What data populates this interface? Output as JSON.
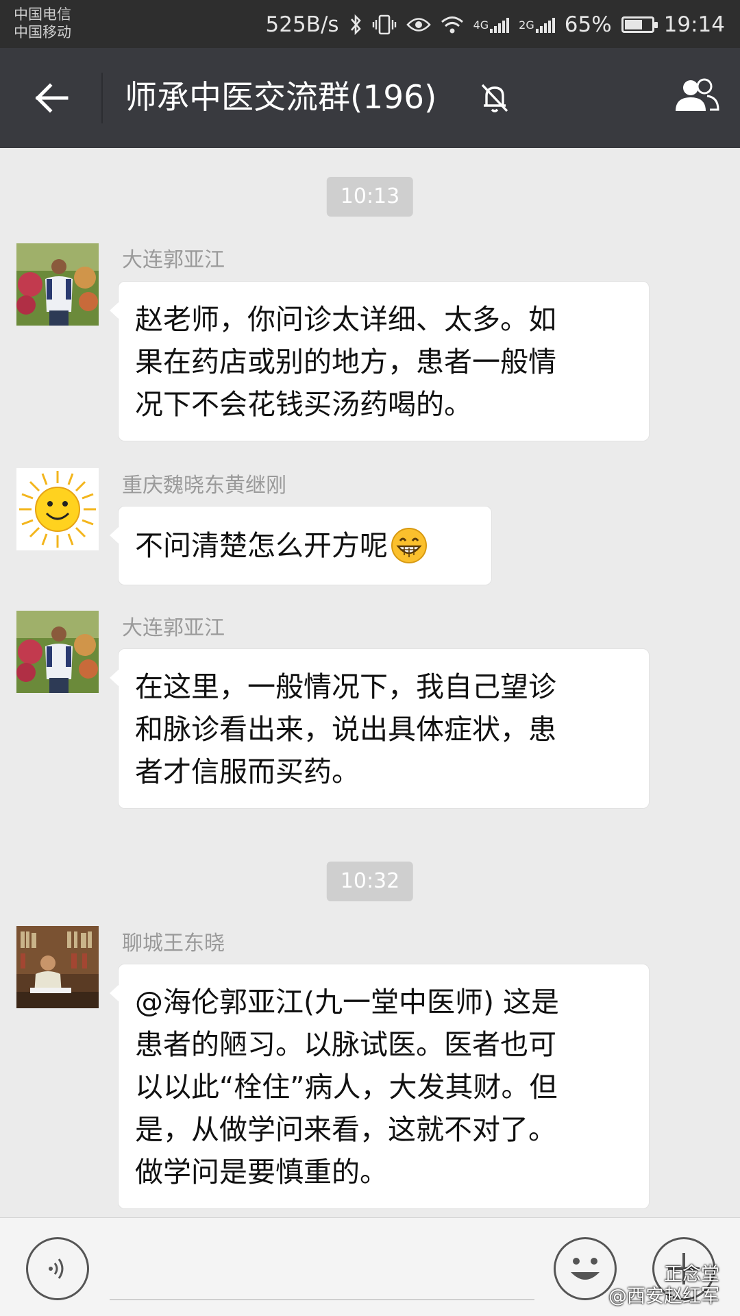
{
  "status_bar": {
    "carrier_1": "中国电信",
    "carrier_2": "中国移动",
    "net_speed": "525B/s",
    "net_4g": "4G",
    "net_2g": "2G",
    "battery": "65%",
    "time": "19:14",
    "battery_level": 0.65
  },
  "header": {
    "title": "师承中医交流群(196)",
    "back_icon": "arrow-left-icon",
    "mute_icon": "bell-muted-icon",
    "members_icon": "group-members-icon"
  },
  "messages": [
    {
      "type": "time",
      "text": "10:13"
    },
    {
      "sender": "大连郭亚江",
      "avatar": "photo-man-outdoor",
      "lines": [
        "赵老师，你问诊太详细、太多。如",
        "果在药店或别的地方，患者一般情",
        "况下不会花钱买汤药喝的。"
      ]
    },
    {
      "sender": "重庆魏晓东黄继刚",
      "avatar": "smiling-sun",
      "lines": [
        "不问清楚怎么开方呢"
      ],
      "emoji": "grin-emoji"
    },
    {
      "sender": "大连郭亚江",
      "avatar": "photo-man-outdoor",
      "lines": [
        "在这里，一般情况下，我自己望诊",
        "和脉诊看出来，说出具体症状，患",
        "者才信服而买药。"
      ]
    },
    {
      "type": "time",
      "text": "10:32"
    },
    {
      "sender": "聊城王东晓",
      "avatar": "photo-man-library",
      "lines": [
        "@海伦郭亚江(九一堂中医师) 这是",
        "患者的陋习。以脉试医。医者也可",
        "以以此“栓住”病人，大发其财。但",
        "是，从做学问来看，这就不对了。",
        "做学问是要慎重的。"
      ]
    }
  ],
  "input_bar": {
    "voice_icon": "voice-icon",
    "emoji_icon": "emoji-icon",
    "plus_icon": "plus-icon"
  },
  "watermark": {
    "line1": "正念堂",
    "line2": "@西安赵红军"
  }
}
